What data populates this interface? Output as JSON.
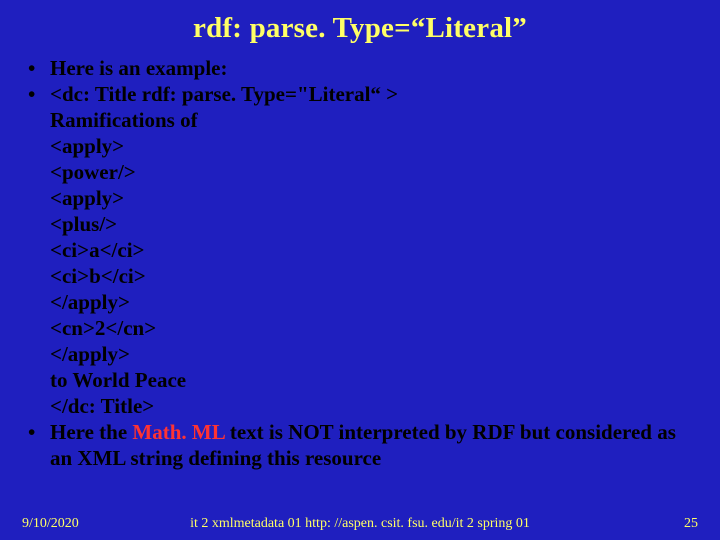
{
  "slide": {
    "title": "rdf: parse. Type=“Literal”",
    "bullets": {
      "b1": "Here is an example:",
      "code": {
        "l0": "<dc: Title rdf: parse. Type=\"Literal“ >",
        "l1": "Ramifications of",
        "l2": "<apply>",
        "l3": "<power/>",
        "l4": "<apply>",
        "l5": "<plus/>",
        "l6": "<ci>a</ci>",
        "l7": "<ci>b</ci>",
        "l8": "</apply>",
        "l9": "<cn>2</cn>",
        "l10": "</apply>",
        "l11": "to World Peace",
        "l12": "</dc: Title>"
      },
      "b3_pre": "Here the ",
      "b3_mathml": "Math. ML",
      "b3_post": " text is NOT interpreted by RDF but considered as an XML string defining this resource"
    },
    "footer": {
      "date": "9/10/2020",
      "center": "it 2 xmlmetadata 01  http: //aspen. csit. fsu. edu/it 2 spring 01",
      "page": "25"
    }
  }
}
